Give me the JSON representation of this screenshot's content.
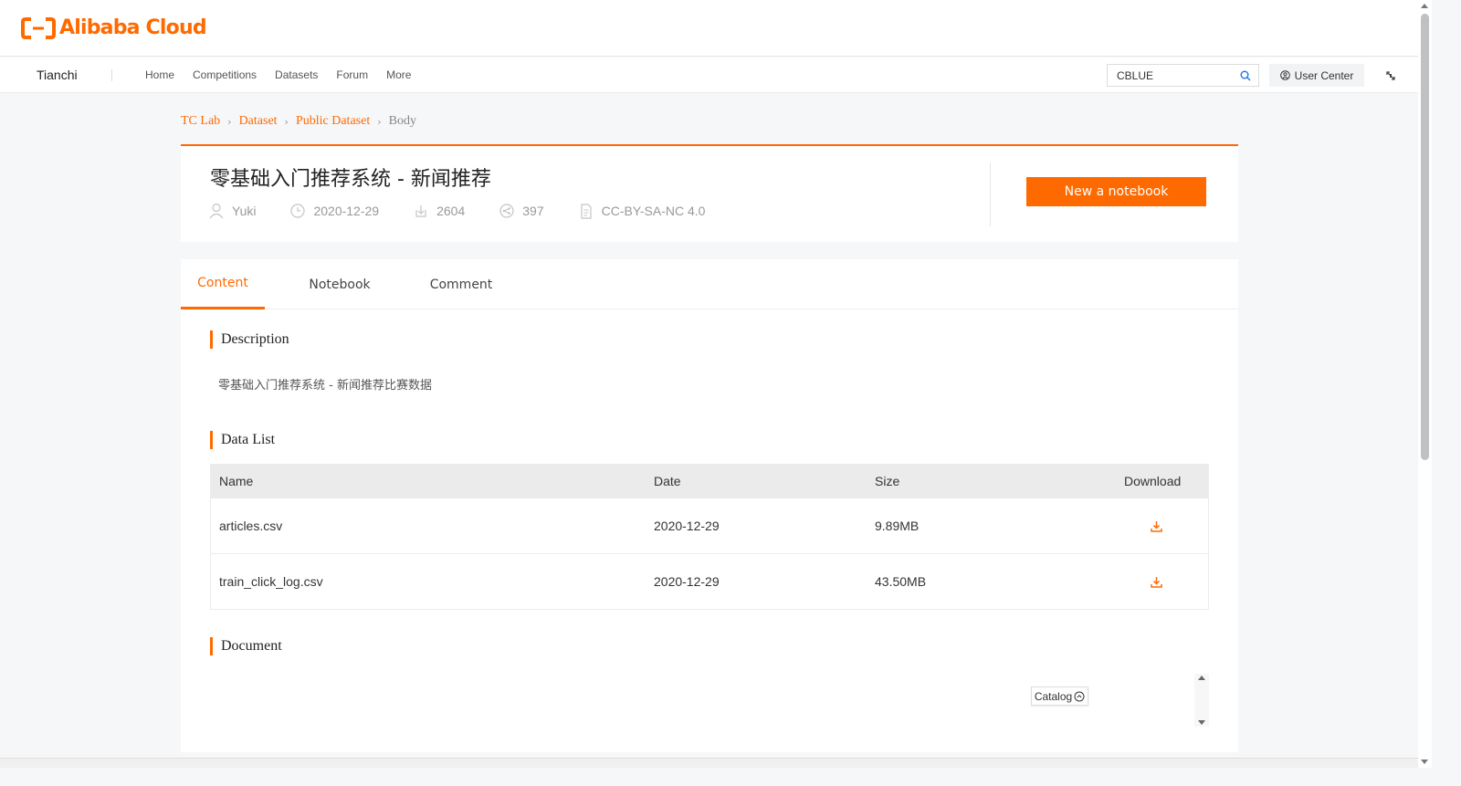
{
  "brand": {
    "logo_text": "Alibaba Cloud",
    "accent": "#ff6a00"
  },
  "nav": {
    "brand": "Tianchi",
    "links": [
      "Home",
      "Competitions",
      "Datasets",
      "Forum",
      "More"
    ],
    "search_value": "CBLUE",
    "user_center": "User Center"
  },
  "breadcrumb": [
    "TC Lab",
    "Dataset",
    "Public Dataset",
    "Body"
  ],
  "dataset": {
    "title": "零基础入门推荐系统 - 新闻推荐",
    "author": "Yuki",
    "date": "2020-12-29",
    "downloads": "2604",
    "shares": "397",
    "license": "CC-BY-SA-NC 4.0",
    "new_notebook": "New a notebook"
  },
  "tabs": [
    "Content",
    "Notebook",
    "Comment"
  ],
  "sections": {
    "description_title": "Description",
    "description_text": "零基础入门推荐系统 - 新闻推荐比赛数据",
    "data_list_title": "Data List",
    "document_title": "Document"
  },
  "table": {
    "headers": [
      "Name",
      "Date",
      "Size",
      "Download"
    ],
    "rows": [
      {
        "name": "articles.csv",
        "date": "2020-12-29",
        "size": "9.89MB"
      },
      {
        "name": "train_click_log.csv",
        "date": "2020-12-29",
        "size": "43.50MB"
      }
    ]
  },
  "catalog": "Catalog",
  "icons": [
    "user-icon",
    "clock-icon",
    "download-icon",
    "share-icon",
    "document-icon",
    "search-icon",
    "refresh-icon",
    "circle-up-icon"
  ]
}
